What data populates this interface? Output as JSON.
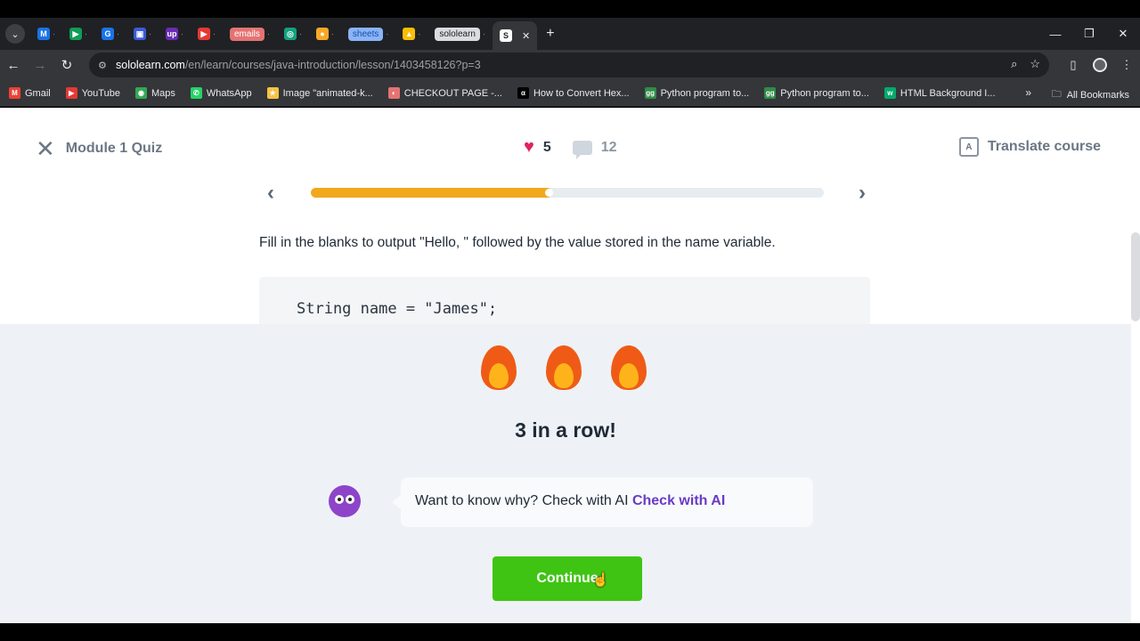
{
  "browser": {
    "tabs": [
      {
        "icon": "M",
        "color": "#1a73e8",
        "label": ""
      },
      {
        "icon": "▶",
        "color": "#0f9d58",
        "label": ""
      },
      {
        "icon": "G",
        "color": "#1a73e8",
        "label": ""
      },
      {
        "icon": "▣",
        "color": "#3b5bdb",
        "label": ""
      },
      {
        "icon": "up",
        "color": "#6b2cb3",
        "label": ""
      },
      {
        "icon": "▶",
        "color": "#e53935",
        "label": ""
      },
      {
        "icon": "",
        "color": "#e57373",
        "label": "emails"
      },
      {
        "icon": "◎",
        "color": "#10a37f",
        "label": ""
      },
      {
        "icon": "●",
        "color": "#f9a825",
        "label": ""
      },
      {
        "icon": "",
        "color": "#8ab4f8",
        "label": "sheets"
      },
      {
        "icon": "▲",
        "color": "#fbbc04",
        "label": ""
      },
      {
        "icon": "",
        "color": "#dadce0",
        "label": "sololearn"
      }
    ],
    "active_tab_label": "",
    "url_host": "sololearn.com",
    "url_path": "/en/learn/courses/java-introduction/lesson/1403458126?p=3",
    "bookmarks": [
      {
        "icon": "M",
        "color": "#ea4335",
        "label": "Gmail"
      },
      {
        "icon": "▶",
        "color": "#e53935",
        "label": "YouTube"
      },
      {
        "icon": "◉",
        "color": "#34a853",
        "label": "Maps"
      },
      {
        "icon": "✆",
        "color": "#25d366",
        "label": "WhatsApp"
      },
      {
        "icon": "★",
        "color": "#f6c344",
        "label": "Image \"animated-k..."
      },
      {
        "icon": "◐",
        "color": "#e57373",
        "label": "CHECKOUT PAGE -..."
      },
      {
        "icon": "α",
        "color": "#000000",
        "label": "How to Convert Hex..."
      },
      {
        "icon": "gg",
        "color": "#2f8d46",
        "label": "Python program to..."
      },
      {
        "icon": "gg",
        "color": "#2f8d46",
        "label": "Python program to..."
      },
      {
        "icon": "w",
        "color": "#04aa6d",
        "label": "HTML Background I..."
      }
    ],
    "all_bookmarks": "All Bookmarks"
  },
  "header": {
    "quiz_title": "Module 1 Quiz",
    "lives": "5",
    "comments": "12",
    "translate": "Translate course"
  },
  "progress": {
    "fraction": 0.47
  },
  "question": "Fill in the blanks to output \"Hello, \" followed by the value stored in the name variable.",
  "code_line": "String name = \"James\";",
  "result": {
    "streak": "3 in a row!",
    "ai_prompt": "Want to know why? Check with AI ",
    "ai_link": "Check with AI",
    "continue": "Continue"
  }
}
